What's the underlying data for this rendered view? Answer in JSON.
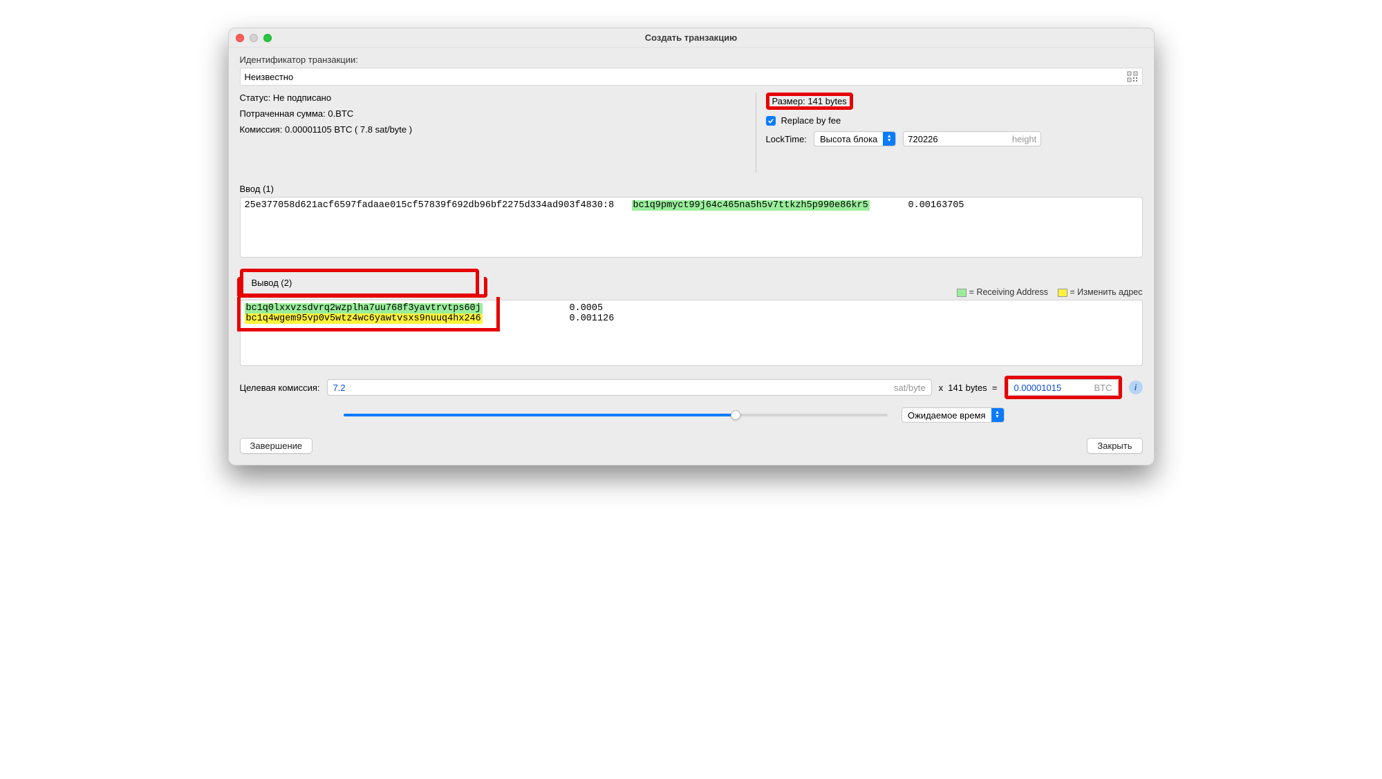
{
  "window": {
    "title": "Создать транзакцию"
  },
  "txid": {
    "label": "Идентификатор транзакции:",
    "value": "Неизвестно"
  },
  "left": {
    "status_label": "Статус:",
    "status_value": "Не подписано",
    "spent_label": "Потраченная сумма:",
    "spent_value": "0.BTC",
    "fee_label": "Комиссия:",
    "fee_value": "0.00001105 BTC  ( 7.8 sat/byte )"
  },
  "right": {
    "size_label": "Размер:",
    "size_value": "141 bytes",
    "rbf_label": "Replace by fee",
    "locktime_label": "LockTime:",
    "locktime_mode": "Высота блока",
    "locktime_value": "720226",
    "locktime_suffix": "height"
  },
  "inputs": {
    "header": "Ввод (1)",
    "rows": [
      {
        "tx": "25e377058d621acf6597fadaae015cf57839f692db96bf2275d334ad903f4830:8",
        "addr": "bc1q9pmyct99j64c465na5h5v7ttkzh5p990e86kr5",
        "amount": "0.00163705"
      }
    ]
  },
  "outputs": {
    "header": "Вывод (2)",
    "legend_recv": "= Receiving Address",
    "legend_change": "= Изменить адрес",
    "rows": [
      {
        "addr": "bc1q0lxxvzsdvrq2wzplha7uu768f3yavtrvtps60j",
        "amount": "0.0005",
        "kind": "recv"
      },
      {
        "addr": "bc1q4wgem95vp0v5wtz4wc6yawtvsxs9nuuq4hx246",
        "amount": "0.001126",
        "kind": "change"
      }
    ]
  },
  "target_fee": {
    "label": "Целевая комиссия:",
    "rate": "7.2",
    "rate_unit": "sat/byte",
    "mult": "x  141 bytes  =",
    "result": "0.00001015",
    "result_unit": "BTC"
  },
  "expected_time": "Ожидаемое время",
  "buttons": {
    "finalize": "Завершение",
    "close": "Закрыть"
  }
}
